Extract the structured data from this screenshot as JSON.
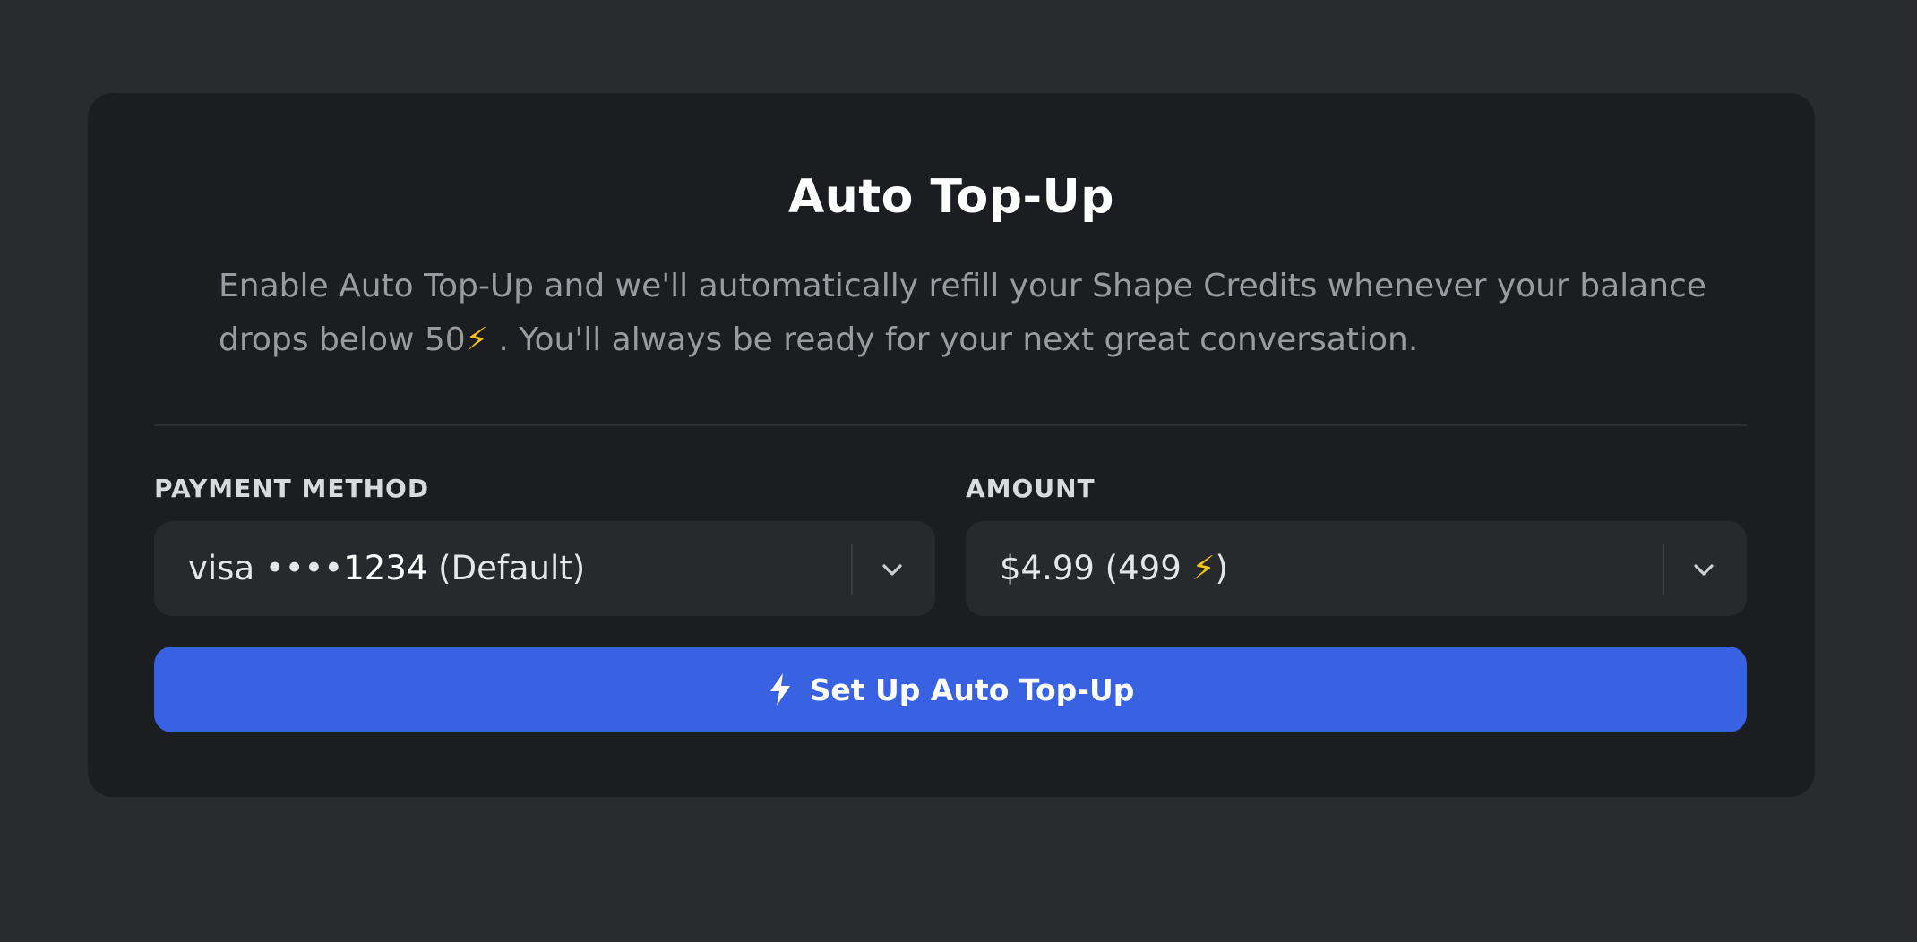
{
  "card": {
    "title": "Auto Top-Up",
    "description_before": "Enable Auto Top-Up and we'll automatically refill your Shape Credits whenever your balance drops below 50",
    "description_after": " . You'll always be ready for your next great conversation."
  },
  "payment": {
    "label": "PAYMENT METHOD",
    "brand": "visa",
    "masked": "••••",
    "last4": "1234",
    "suffix": "(Default)"
  },
  "amount": {
    "label": "AMOUNT",
    "price": "$4.99 (499 ",
    "close": ")"
  },
  "cta": {
    "label": "Set Up Auto Top-Up"
  },
  "icons": {
    "credit": "lightning-bolt-emoji",
    "dropdown": "chevron-down-icon",
    "button": "lightning-bolt-icon"
  },
  "colors": {
    "page_bg": "#2a2b2f",
    "card_bg": "#1c1d20",
    "field_bg": "#28292d",
    "accent": "#3862e2",
    "bolt": "#f5c518"
  }
}
